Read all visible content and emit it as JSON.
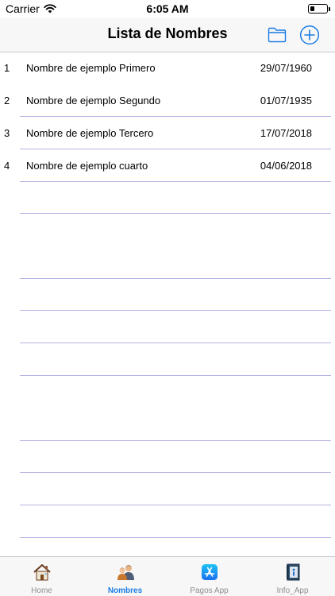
{
  "status_bar": {
    "carrier": "Carrier",
    "time": "6:05 AM",
    "battery_level": 0.25
  },
  "nav": {
    "title": "Lista de Nombres",
    "folder_icon": "folder-icon",
    "add_icon": "plus-circle-icon",
    "tint": "#1a7ce6"
  },
  "rows": [
    {
      "num": "1",
      "name": "Nombre de ejemplo Primero",
      "date": "29/07/1960"
    },
    {
      "num": "2",
      "name": "Nombre de ejemplo Segundo",
      "date": "01/07/1935"
    },
    {
      "num": "3",
      "name": "Nombre de ejemplo Tercero",
      "date": "17/07/2018"
    },
    {
      "num": "4",
      "name": "Nombre de ejemplo cuarto",
      "date": "04/06/2018"
    }
  ],
  "separator_color": "#b4b4e4",
  "tabs": [
    {
      "label": "Home",
      "icon": "house-icon"
    },
    {
      "label": "Nombres",
      "icon": "people-icon",
      "active": true
    },
    {
      "label": "Pagos App",
      "icon": "app-store-icon"
    },
    {
      "label": "Info_App",
      "icon": "info-book-icon"
    }
  ],
  "colors": {
    "active_tab": "#1a7ce6",
    "inactive_tab": "#8e8e93"
  }
}
